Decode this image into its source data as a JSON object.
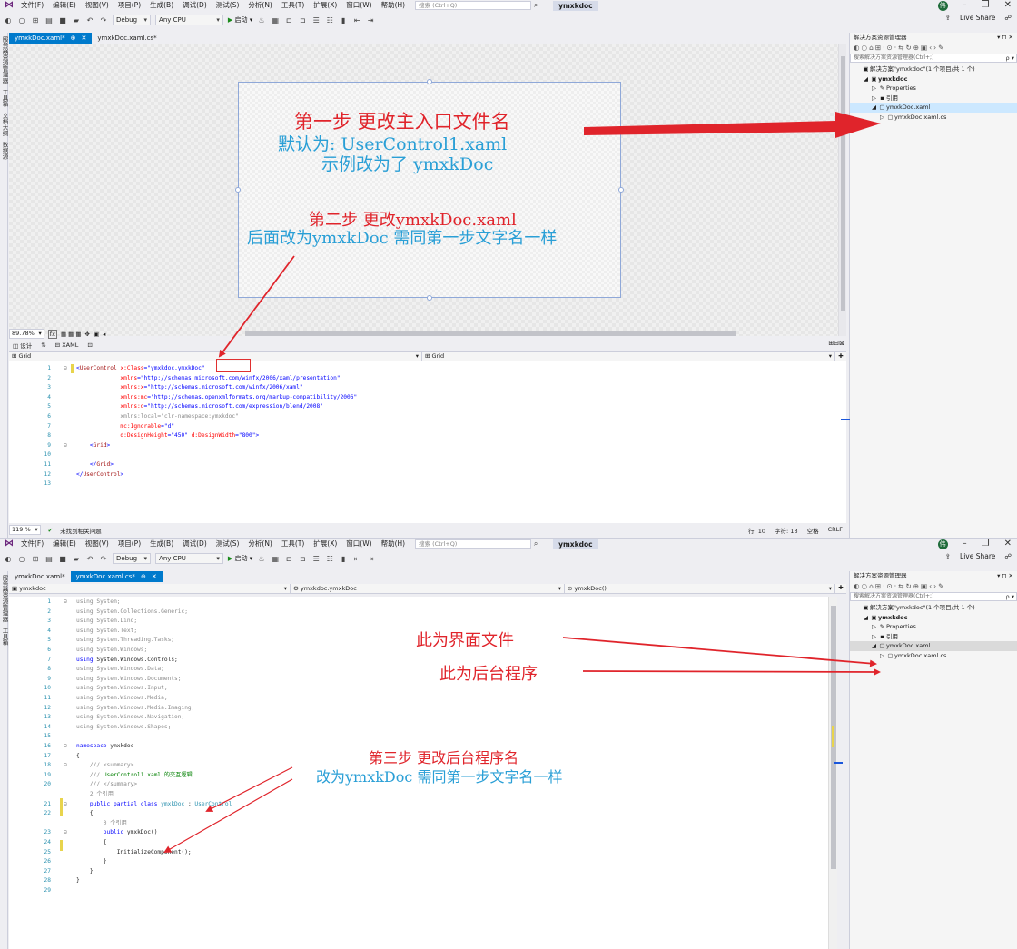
{
  "menu": {
    "items": [
      "文件(F)",
      "编辑(E)",
      "视图(V)",
      "项目(P)",
      "生成(B)",
      "调试(D)",
      "测试(S)",
      "分析(N)",
      "工具(T)",
      "扩展(X)",
      "窗口(W)",
      "帮助(H)"
    ],
    "search_placeholder": "搜索 (Ctrl+Q)",
    "solution_name": "ymxkdoc",
    "account_initial": "伟"
  },
  "toolbar": {
    "config": "Debug",
    "platform": "Any CPU",
    "run_label": "启动",
    "live_share": "Live Share"
  },
  "window1": {
    "tabs": [
      {
        "label": "ymxkDoc.xaml*",
        "active": true
      },
      {
        "label": "ymxkDoc.xaml.cs*",
        "active": false
      }
    ],
    "left_rail": [
      "服务器资源管理器",
      "工具箱",
      "文档大纲",
      "数据源"
    ],
    "zoom": "89.78%",
    "split_tabs": [
      "设计",
      "XAML"
    ],
    "breadcrumb_left": "Grid",
    "breadcrumb_right": "Grid",
    "xaml_lines": [
      {
        "n": "1",
        "fold": "⊟",
        "parts": [
          [
            "x-bracket",
            "<"
          ],
          [
            "x-tag",
            "UserControl"
          ],
          [
            "x-attr",
            " x:Class"
          ],
          [
            "x-bracket",
            "="
          ],
          [
            "x-val",
            "\"ymxkdoc.ymxkDoc\""
          ]
        ]
      },
      {
        "n": "2",
        "fold": "",
        "parts": [
          [
            "x-attr",
            "             xmlns"
          ],
          [
            "x-bracket",
            "="
          ],
          [
            "x-val",
            "\"http://schemas.microsoft.com/winfx/2006/xaml/presentation\""
          ]
        ]
      },
      {
        "n": "3",
        "fold": "",
        "parts": [
          [
            "x-attr",
            "             xmlns:x"
          ],
          [
            "x-bracket",
            "="
          ],
          [
            "x-val",
            "\"http://schemas.microsoft.com/winfx/2006/xaml\""
          ]
        ]
      },
      {
        "n": "4",
        "fold": "",
        "parts": [
          [
            "x-attr",
            "             xmlns:mc"
          ],
          [
            "x-bracket",
            "="
          ],
          [
            "x-val",
            "\"http://schemas.openxmlformats.org/markup-compatibility/2006\""
          ]
        ]
      },
      {
        "n": "5",
        "fold": "",
        "parts": [
          [
            "x-attr",
            "             xmlns:d"
          ],
          [
            "x-bracket",
            "="
          ],
          [
            "x-val",
            "\"http://schemas.microsoft.com/expression/blend/2008\""
          ]
        ]
      },
      {
        "n": "6",
        "fold": "",
        "parts": [
          [
            "g",
            "             xmlns:local=\"clr-namespace:ymxkdoc\""
          ]
        ]
      },
      {
        "n": "7",
        "fold": "",
        "parts": [
          [
            "x-attr",
            "             mc:Ignorable"
          ],
          [
            "x-bracket",
            "="
          ],
          [
            "x-val",
            "\"d\""
          ]
        ]
      },
      {
        "n": "8",
        "fold": "",
        "parts": [
          [
            "x-attr",
            "             d:DesignHeight"
          ],
          [
            "x-bracket",
            "="
          ],
          [
            "x-val",
            "\"450\""
          ],
          [
            "x-attr",
            " d:DesignWidth"
          ],
          [
            "x-bracket",
            "="
          ],
          [
            "x-val",
            "\"800\""
          ],
          [
            "x-bracket",
            ">"
          ]
        ]
      },
      {
        "n": "9",
        "fold": "⊟",
        "parts": [
          [
            "x-bracket",
            "    <"
          ],
          [
            "x-tag",
            "Grid"
          ],
          [
            "x-bracket",
            ">"
          ]
        ]
      },
      {
        "n": "10",
        "fold": "",
        "parts": [
          [
            "x-bracket",
            ""
          ]
        ]
      },
      {
        "n": "11",
        "fold": "",
        "parts": [
          [
            "x-bracket",
            "    </"
          ],
          [
            "x-tag",
            "Grid"
          ],
          [
            "x-bracket",
            ">"
          ]
        ]
      },
      {
        "n": "12",
        "fold": "",
        "parts": [
          [
            "x-bracket",
            "</"
          ],
          [
            "x-tag",
            "UserControl"
          ],
          [
            "x-bracket",
            ">"
          ]
        ]
      },
      {
        "n": "13",
        "fold": "",
        "parts": [
          [
            "x-bracket",
            ""
          ]
        ]
      }
    ],
    "status": {
      "zoom": "119 %",
      "issues": "未找到相关问题",
      "line": "行: 10",
      "char": "字符: 13",
      "space": "空格",
      "crlf": "CRLF"
    },
    "solution_panel": {
      "title": "解决方案资源管理器",
      "search_placeholder": "搜索解决方案资源管理器(Ctrl+;)",
      "items": [
        {
          "label": "解决方案\"ymxkdoc\"(1 个项目/共 1 个)",
          "indent": 0,
          "icon": "solution-icon",
          "glyph": "▣"
        },
        {
          "label": "ymxkdoc",
          "indent": 1,
          "icon": "project-icon",
          "glyph": "▣",
          "bold": true
        },
        {
          "label": "Properties",
          "indent": 2,
          "icon": "wrench-icon",
          "glyph": "✎"
        },
        {
          "label": "引用",
          "indent": 2,
          "icon": "references-icon",
          "glyph": "▪"
        },
        {
          "label": "ymxkDoc.xaml",
          "indent": 2,
          "icon": "xaml-file-icon",
          "glyph": "▢",
          "selected": true
        },
        {
          "label": "ymxkDoc.xaml.cs",
          "indent": 3,
          "icon": "cs-file-icon",
          "glyph": "▢"
        }
      ]
    }
  },
  "window2": {
    "tabs": [
      {
        "label": "ymxkDoc.xaml*",
        "active": false
      },
      {
        "label": "ymxkDoc.xaml.cs*",
        "active": true
      }
    ],
    "left_rail": [
      "服务器资源管理器",
      "工具箱"
    ],
    "nav": [
      "ymxkdoc",
      "ymxkdoc.ymxkDoc",
      "ymxkDoc()"
    ],
    "cs_lines": [
      {
        "n": "1",
        "fold": "⊟",
        "parts": [
          [
            "g",
            "using System;"
          ]
        ]
      },
      {
        "n": "2",
        "fold": "",
        "parts": [
          [
            "g",
            "using System.Collections.Generic;"
          ]
        ]
      },
      {
        "n": "3",
        "fold": "",
        "parts": [
          [
            "g",
            "using System.Linq;"
          ]
        ]
      },
      {
        "n": "4",
        "fold": "",
        "parts": [
          [
            "g",
            "using System.Text;"
          ]
        ]
      },
      {
        "n": "5",
        "fold": "",
        "parts": [
          [
            "g",
            "using System.Threading.Tasks;"
          ]
        ]
      },
      {
        "n": "6",
        "fold": "",
        "parts": [
          [
            "g",
            "using System.Windows;"
          ]
        ]
      },
      {
        "n": "7",
        "fold": "",
        "parts": [
          [
            "k",
            "using"
          ],
          [
            "",
            " System.Windows.Controls;"
          ]
        ]
      },
      {
        "n": "8",
        "fold": "",
        "parts": [
          [
            "g",
            "using System.Windows.Data;"
          ]
        ]
      },
      {
        "n": "9",
        "fold": "",
        "parts": [
          [
            "g",
            "using System.Windows.Documents;"
          ]
        ]
      },
      {
        "n": "10",
        "fold": "",
        "parts": [
          [
            "g",
            "using System.Windows.Input;"
          ]
        ]
      },
      {
        "n": "11",
        "fold": "",
        "parts": [
          [
            "g",
            "using System.Windows.Media;"
          ]
        ]
      },
      {
        "n": "12",
        "fold": "",
        "parts": [
          [
            "g",
            "using System.Windows.Media.Imaging;"
          ]
        ]
      },
      {
        "n": "13",
        "fold": "",
        "parts": [
          [
            "g",
            "using System.Windows.Navigation;"
          ]
        ]
      },
      {
        "n": "14",
        "fold": "",
        "parts": [
          [
            "g",
            "using System.Windows.Shapes;"
          ]
        ]
      },
      {
        "n": "15",
        "fold": "",
        "parts": [
          [
            "",
            ""
          ]
        ]
      },
      {
        "n": "16",
        "fold": "⊟",
        "parts": [
          [
            "k",
            "namespace"
          ],
          [
            "",
            " ymxkdoc"
          ]
        ]
      },
      {
        "n": "17",
        "fold": "",
        "parts": [
          [
            "",
            "{"
          ]
        ]
      },
      {
        "n": "18",
        "fold": "⊟",
        "parts": [
          [
            "g",
            "    /// <summary>"
          ]
        ]
      },
      {
        "n": "19",
        "fold": "",
        "parts": [
          [
            "g",
            "    /// "
          ],
          [
            "c",
            "UserControl1.xaml 的交互逻辑"
          ]
        ]
      },
      {
        "n": "20",
        "fold": "",
        "parts": [
          [
            "g",
            "    /// </summary>"
          ]
        ]
      },
      {
        "n": "",
        "fold": "",
        "parts": [
          [
            "g",
            "    2 个引用"
          ]
        ]
      },
      {
        "n": "21",
        "fold": "⊟",
        "parts": [
          [
            "k",
            "    public partial class "
          ],
          [
            "t",
            "ymxkDoc"
          ],
          [
            "",
            " : "
          ],
          [
            "t",
            "UserControl"
          ]
        ]
      },
      {
        "n": "22",
        "fold": "",
        "parts": [
          [
            "",
            "    {"
          ]
        ]
      },
      {
        "n": "",
        "fold": "",
        "parts": [
          [
            "g",
            "        0 个引用"
          ]
        ]
      },
      {
        "n": "23",
        "fold": "⊟",
        "parts": [
          [
            "k",
            "        public "
          ],
          [
            "",
            "ymxkDoc()"
          ]
        ]
      },
      {
        "n": "24",
        "fold": "",
        "parts": [
          [
            "",
            "        {"
          ]
        ]
      },
      {
        "n": "25",
        "fold": "",
        "parts": [
          [
            "",
            "            InitializeComponent();"
          ]
        ]
      },
      {
        "n": "26",
        "fold": "",
        "parts": [
          [
            "",
            "        }"
          ]
        ]
      },
      {
        "n": "27",
        "fold": "",
        "parts": [
          [
            "",
            "    }"
          ]
        ]
      },
      {
        "n": "28",
        "fold": "",
        "parts": [
          [
            "",
            "}"
          ]
        ]
      },
      {
        "n": "29",
        "fold": "",
        "parts": [
          [
            "",
            ""
          ]
        ]
      }
    ],
    "solution_panel": {
      "title": "解决方案资源管理器",
      "search_placeholder": "搜索解决方案资源管理器(Ctrl+;)",
      "items": [
        {
          "label": "解决方案\"ymxkdoc\"(1 个项目/共 1 个)",
          "indent": 0,
          "icon": "solution-icon",
          "glyph": "▣"
        },
        {
          "label": "ymxkdoc",
          "indent": 1,
          "icon": "project-icon",
          "glyph": "▣",
          "bold": true
        },
        {
          "label": "Properties",
          "indent": 2,
          "icon": "wrench-icon",
          "glyph": "✎"
        },
        {
          "label": "引用",
          "indent": 2,
          "icon": "references-icon",
          "glyph": "▪"
        },
        {
          "label": "ymxkDoc.xaml",
          "indent": 2,
          "icon": "xaml-file-icon",
          "glyph": "▢",
          "selected": true
        },
        {
          "label": "ymxkDoc.xaml.cs",
          "indent": 3,
          "icon": "cs-file-icon",
          "glyph": "▢"
        }
      ]
    }
  },
  "annotations": {
    "step1_line1": "第一步  更改主入口文件名",
    "step1_line2": "默认为: UserControl1.xaml",
    "step1_line3": "示例改为了 ymxkDoc",
    "step2_line1": "第二步  更改ymxkDoc.xaml",
    "step2_line2": "后面改为ymxkDoc 需同第一步文字名一样",
    "ui_file": "此为界面文件",
    "backend": "此为后台程序",
    "step3_line1": "第三步  更改后台程序名",
    "step3_line2": "改为ymxkDoc 需同第一步文字名一样"
  },
  "colors": {
    "accent": "#007acc",
    "annotation_red": "#e0242b",
    "annotation_blue": "#2a9fd6"
  }
}
